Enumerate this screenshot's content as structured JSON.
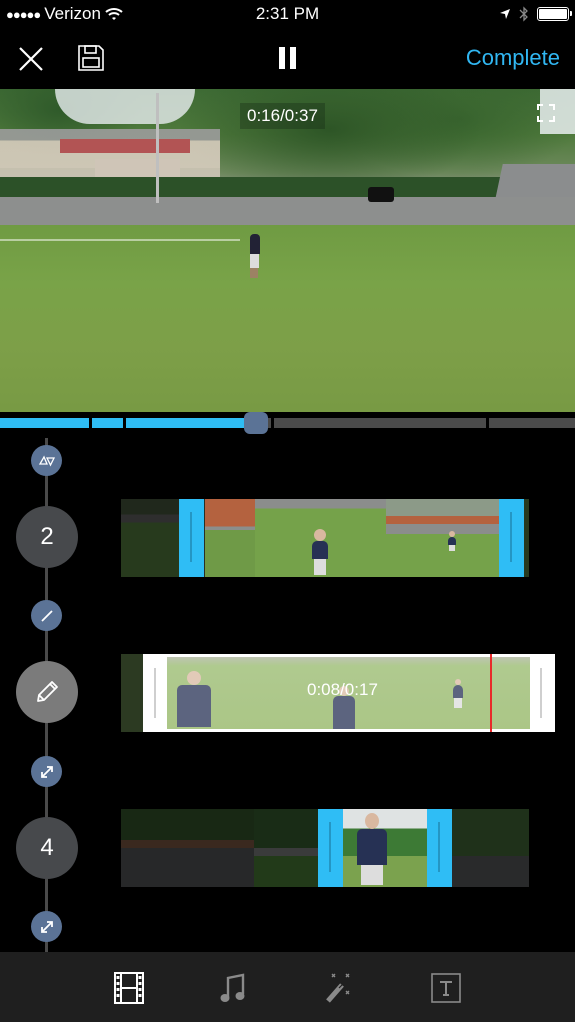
{
  "status_bar": {
    "signal": "●●●●●",
    "carrier": "Verizon",
    "time": "2:31 PM",
    "icons": [
      "wifi-icon",
      "location-arrow-icon",
      "bluetooth-icon",
      "battery-icon"
    ]
  },
  "toolbar": {
    "close_icon": "close-icon",
    "save_icon": "save-icon",
    "pause_icon": "pause-icon",
    "complete_label": "Complete",
    "accent_color": "#31b7f2"
  },
  "preview": {
    "timecode": "0:16/0:37",
    "fullscreen_icon": "fullscreen-icon"
  },
  "scrubber": {
    "played_color": "#2fbdf5",
    "unplayed_color": "#4b4b4b",
    "position": "0:16",
    "duration": "0:37",
    "progress_fraction": 0.44
  },
  "timeline": {
    "nodes": [
      {
        "type": "transition",
        "icon": "transition-triangles-icon"
      },
      {
        "type": "clip",
        "label": "2"
      },
      {
        "type": "transition",
        "icon": "slash-transition-icon"
      },
      {
        "type": "clip",
        "icon": "pencil-icon",
        "active": true
      },
      {
        "type": "transition",
        "icon": "expand-arrows-icon"
      },
      {
        "type": "clip",
        "label": "4"
      },
      {
        "type": "transition",
        "icon": "expand-arrows-icon"
      }
    ],
    "clips": [
      {
        "id": "clip-2",
        "state": "trimmed"
      },
      {
        "id": "clip-3",
        "state": "editing",
        "timecode": "0:08/0:17"
      },
      {
        "id": "clip-4",
        "state": "trimmed"
      }
    ]
  },
  "tabbar": {
    "tabs": [
      {
        "icon": "film-icon",
        "active": true
      },
      {
        "icon": "music-note-icon",
        "active": false
      },
      {
        "icon": "magic-wand-icon",
        "active": false
      },
      {
        "icon": "text-icon",
        "active": false
      }
    ]
  }
}
